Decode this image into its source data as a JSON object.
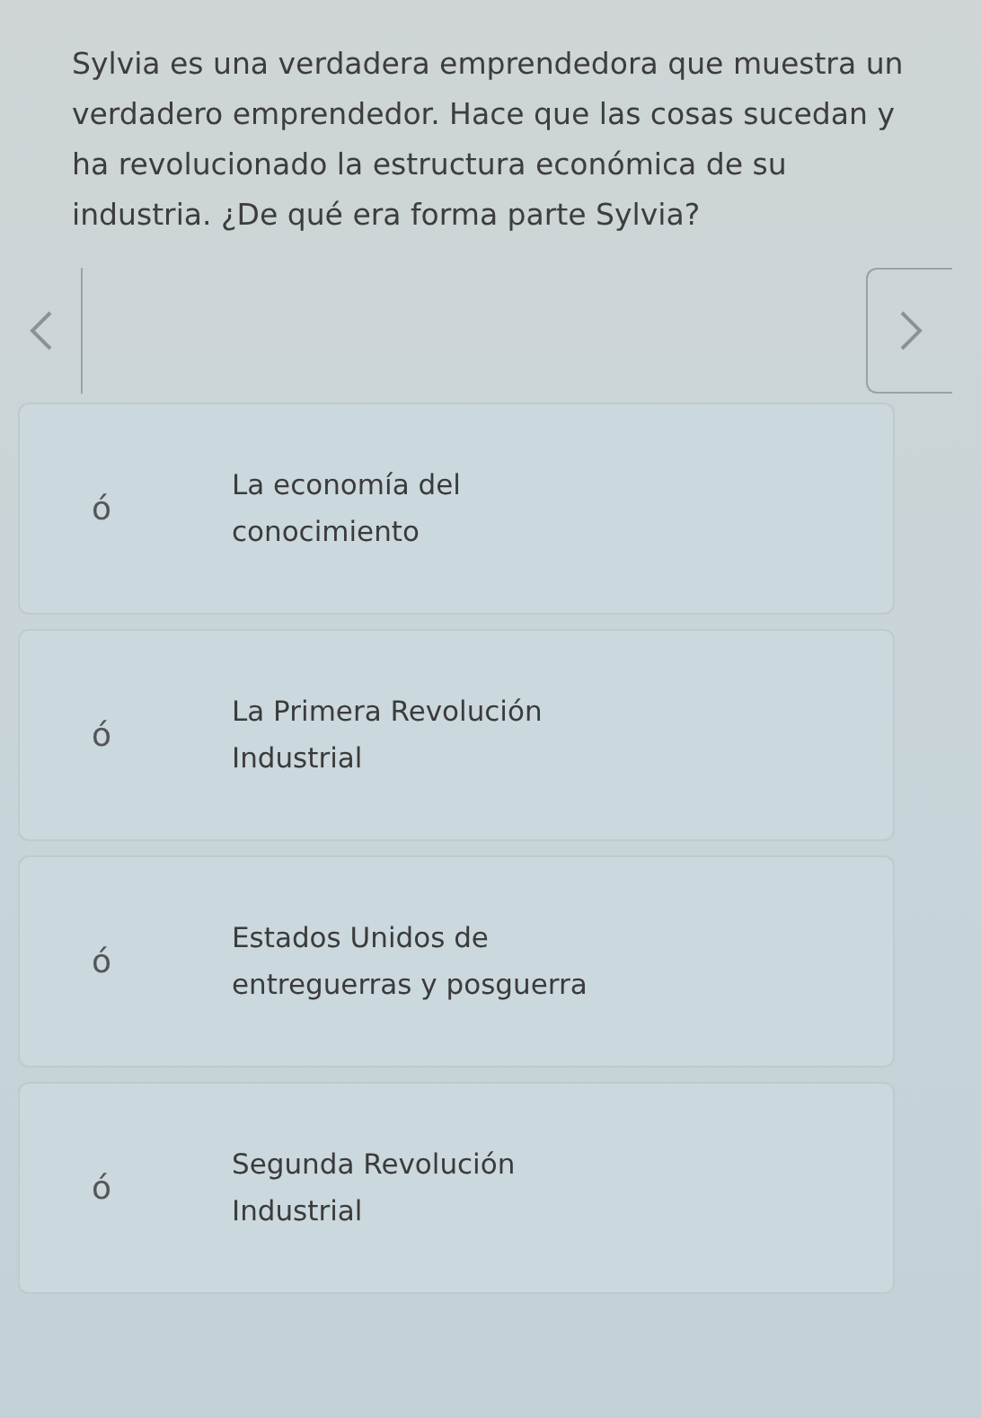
{
  "question": "Sylvia es una verdadera emprendedora que muestra un verdadero emprendedor. Hace que las cosas sucedan y ha revolucionado la estructura económica de su industria. ¿De qué era forma parte Sylvia?",
  "options": [
    {
      "marker": "ó",
      "text": "La economía del conocimiento"
    },
    {
      "marker": "ó",
      "text": "La Primera Revolución Industrial"
    },
    {
      "marker": "ó",
      "text": "Estados Unidos de entreguerras y posguerra"
    },
    {
      "marker": "ó",
      "text": "Segunda Revolución Industrial"
    }
  ]
}
